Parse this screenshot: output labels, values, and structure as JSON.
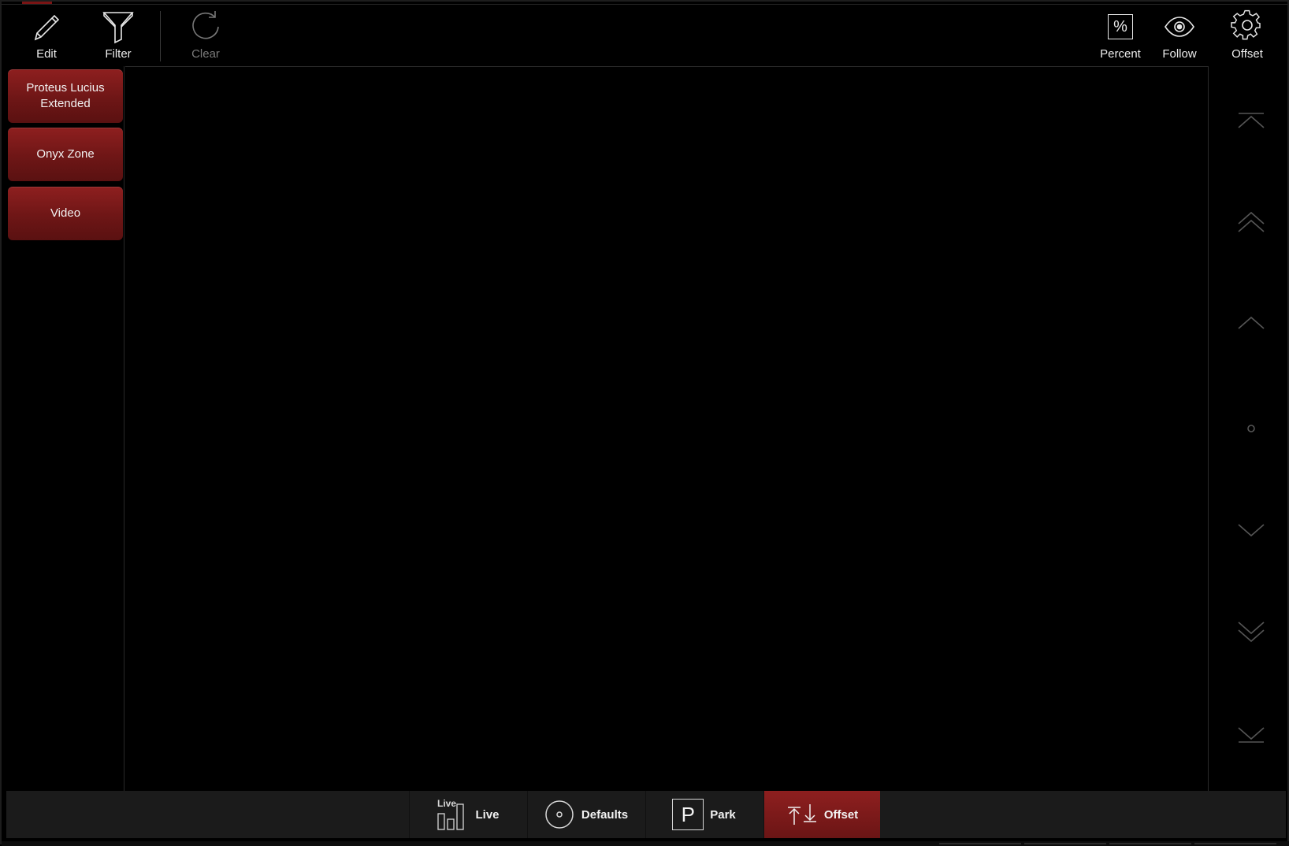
{
  "toolbar": {
    "edit_label": "Edit",
    "filter_label": "Filter",
    "clear_label": "Clear",
    "percent_label": "Percent",
    "percent_glyph": "%",
    "follow_label": "Follow",
    "offset_label": "Offset"
  },
  "sidebar": {
    "groups": [
      {
        "label": "Proteus Lucius Extended"
      },
      {
        "label": "Onyx Zone"
      },
      {
        "label": "Video"
      }
    ]
  },
  "bottom_bar": {
    "live_label": "Live",
    "live_icon_text": "Live",
    "defaults_label": "Defaults",
    "park_label": "Park",
    "park_icon_text": "P",
    "offset_label": "Offset",
    "active": "Offset"
  },
  "colors": {
    "accent": "#7a1a1a",
    "background": "#000000",
    "bar": "#1b1b1b"
  },
  "icons": {
    "edit": "pencil-icon",
    "filter": "funnel-icon",
    "clear": "refresh-icon",
    "percent": "percent-icon",
    "follow": "eye-icon",
    "offset": "gear-icon"
  }
}
